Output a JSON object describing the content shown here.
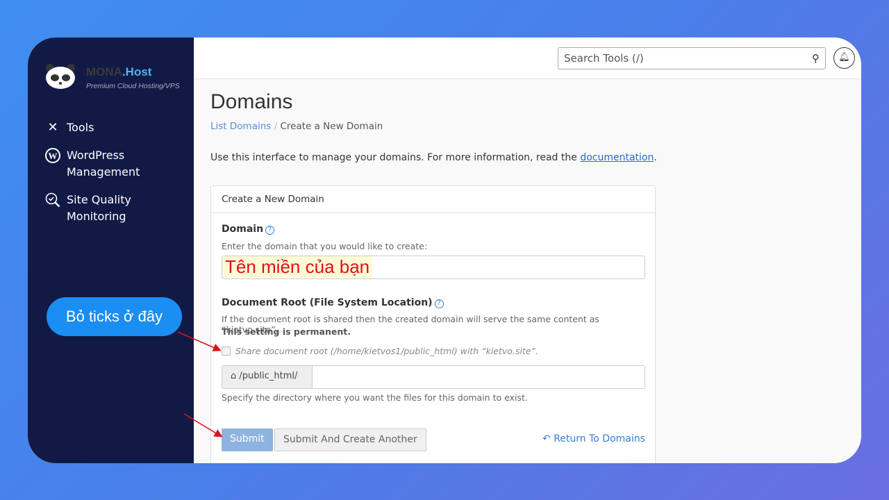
{
  "sidebar": {
    "brand_main": "MONA",
    "brand_suffix": ".Host",
    "tagline": "Premium Cloud Hosting/VPS",
    "items": [
      {
        "label": "Tools",
        "icon": "tools-icon"
      },
      {
        "label": "WordPress Management",
        "icon": "wordpress-icon"
      },
      {
        "label": "Site Quality Monitoring",
        "icon": "site-quality-icon"
      }
    ]
  },
  "header": {
    "search_placeholder": "Search Tools (/)"
  },
  "page": {
    "title": "Domains",
    "breadcrumb": [
      "List Domains",
      "Create a New Domain"
    ],
    "intro": "Use this interface to manage your domains. For more information, read the ",
    "intro_link": "documentation",
    "intro_end": "."
  },
  "form": {
    "panel_title": "Create a New Domain",
    "domain_label": "Domain",
    "domain_hint": "Enter the domain that you would like to create:",
    "domain_value": "Tên miền của bạn",
    "docroot_label": "Document Root (File System Location)",
    "docroot_hint": "If the document root is shared then the created domain will serve the same content as “kietvo.site”.",
    "docroot_warning": "This setting is permanent.",
    "share_checkbox": "Share document root (/home/kietvos1/public_html) with “kietvo.site”.",
    "share_checked": false,
    "path_prefix": "/public_html/",
    "path_value": "",
    "path_hint": "Specify the directory where you want the files for this domain to exist.",
    "submit": "Submit",
    "submit_another": "Submit And Create Another",
    "return": "Return To Domains"
  },
  "annotation": {
    "callout": "Bỏ ticks ở đây",
    "arrow_color": "#e0101a",
    "callout_color": "#1a8ef2"
  }
}
